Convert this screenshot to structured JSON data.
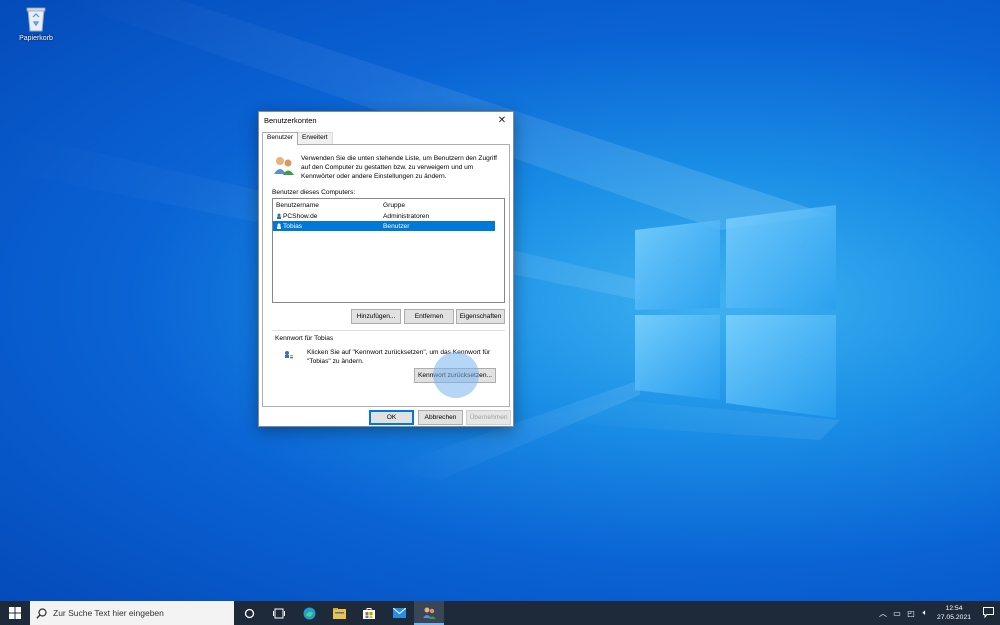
{
  "desktop": {
    "recycle_bin_label": "Papierkorb"
  },
  "dialog": {
    "title": "Benutzerkonten",
    "close_glyph": "✕",
    "tabs": [
      {
        "label": "Benutzer",
        "active": true
      },
      {
        "label": "Erweitert",
        "active": false
      }
    ],
    "intro_text": "Verwenden Sie die unten stehende Liste, um Benutzern den Zugriff auf den Computer zu gestatten bzw. zu verweigern und um Kennwörter oder andere Einstellungen zu ändern.",
    "list_label": "Benutzer dieses Computers:",
    "columns": [
      "Benutzername",
      "Gruppe"
    ],
    "users": [
      {
        "name": "PCShow.de",
        "group": "Administratoren",
        "selected": false
      },
      {
        "name": "Tobias",
        "group": "Benutzer",
        "selected": true
      }
    ],
    "buttons": {
      "add": "Hinzufügen...",
      "remove": "Entfernen",
      "properties": "Eigenschaften"
    },
    "password_group": {
      "label": "Kennwort für Tobias",
      "text": "Klicken Sie auf \"Kennwort zurücksetzen\", um das Kennwort für \"Tobias\" zu ändern.",
      "reset_button": "Kennwort zurücksetzen..."
    },
    "footer": {
      "ok": "OK",
      "cancel": "Abbrechen",
      "apply": "Übernehmen"
    }
  },
  "taskbar": {
    "search_placeholder": "Zur Suche Text hier eingeben",
    "clock_time": "12:54",
    "clock_date": "27.05.2021"
  },
  "colors": {
    "accent": "#0078d7",
    "taskbar": "#1e2a3a"
  }
}
